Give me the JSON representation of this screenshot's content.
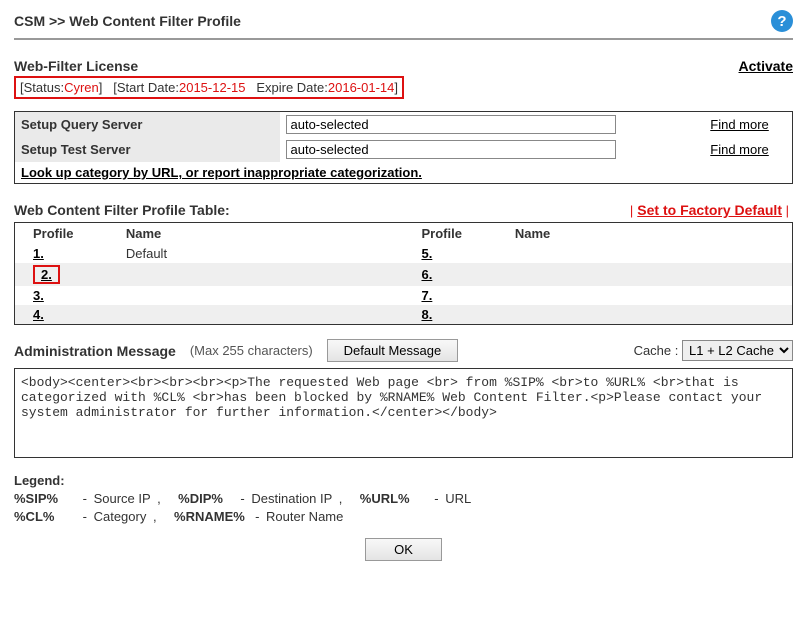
{
  "breadcrumb": "CSM >> Web Content Filter Profile",
  "license": {
    "title": "Web-Filter License",
    "activate": "Activate",
    "status_label": "Status:",
    "status_value": "Cyren",
    "start_label": "Start Date:",
    "start_value": "2015-12-15",
    "expire_label": "Expire Date:",
    "expire_value": "2016-01-14"
  },
  "setup": {
    "query_label": "Setup Query Server",
    "query_value": "auto-selected",
    "test_label": "Setup Test Server",
    "test_value": "auto-selected",
    "find_more": "Find more",
    "lookup": "Look up category by URL, or report inappropriate categorization."
  },
  "profile_table": {
    "title": "Web Content Filter Profile Table:",
    "reset": "Set to Factory Default",
    "headers": {
      "profile": "Profile",
      "name": "Name"
    },
    "rows_left": [
      {
        "num": "1.",
        "name": "Default",
        "highlight": false
      },
      {
        "num": "2.",
        "name": "",
        "highlight": true
      },
      {
        "num": "3.",
        "name": "",
        "highlight": false
      },
      {
        "num": "4.",
        "name": "",
        "highlight": false
      }
    ],
    "rows_right": [
      {
        "num": "5.",
        "name": ""
      },
      {
        "num": "6.",
        "name": ""
      },
      {
        "num": "7.",
        "name": ""
      },
      {
        "num": "8.",
        "name": ""
      }
    ]
  },
  "admin": {
    "title": "Administration Message",
    "maxchars": "(Max 255 characters)",
    "default_btn": "Default Message",
    "cache_label": "Cache :",
    "cache_value": "L1 + L2 Cache",
    "message": "<body><center><br><br><br><p>The requested Web page <br> from %SIP% <br>to %URL% <br>that is categorized with %CL% <br>has been blocked by %RNAME% Web Content Filter.<p>Please contact your system administrator for further information.</center></body>"
  },
  "legend": {
    "title": "Legend:",
    "items": [
      {
        "key": "%SIP%",
        "desc": "Source IP"
      },
      {
        "key": "%DIP%",
        "desc": "Destination IP"
      },
      {
        "key": "%URL%",
        "desc": "URL"
      },
      {
        "key": "%CL%",
        "desc": "Category"
      },
      {
        "key": "%RNAME%",
        "desc": "Router Name"
      }
    ]
  },
  "ok_label": "OK"
}
